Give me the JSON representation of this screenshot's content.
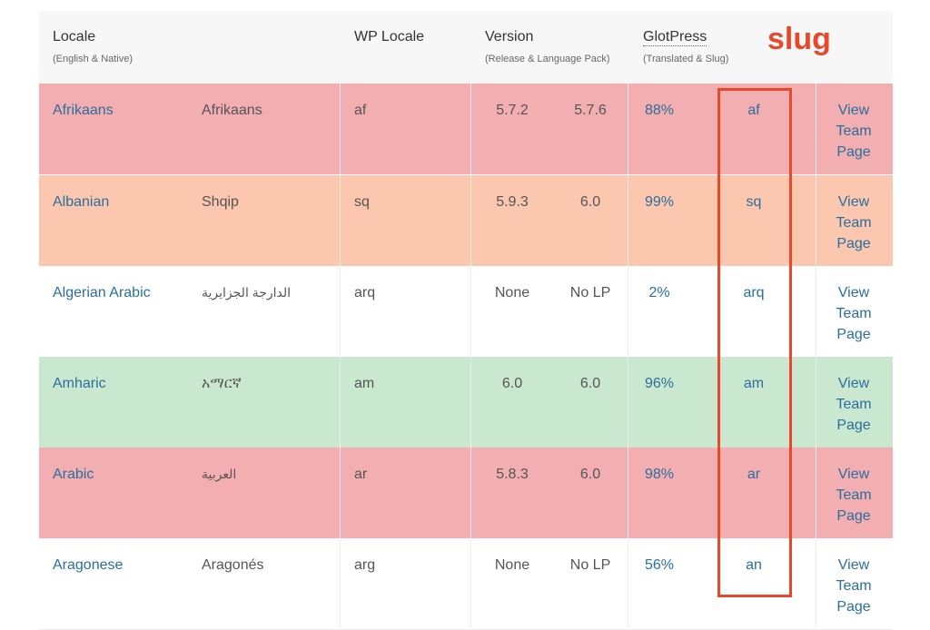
{
  "header": {
    "locale_title": "Locale",
    "locale_sub": "(English & Native)",
    "wp_locale_title": "WP Locale",
    "version_title": "Version",
    "version_sub": "(Release & Language Pack)",
    "glotpress_title": "GlotPress",
    "glotpress_sub": "(Translated & Slug)"
  },
  "annotation": {
    "slug_label": "slug",
    "highlight_color": "#e8492b"
  },
  "colors": {
    "red_row": "#f2aeb0",
    "orange_row": "#fbc7ae",
    "green_row": "#c9e8cf",
    "white_row": "#ffffff",
    "link": "#2a6f9e"
  },
  "rows": [
    {
      "english": "Afrikaans",
      "native": "Afrikaans",
      "wp_locale": "af",
      "release": "5.7.2",
      "language_pack": "5.7.6",
      "translated": "88%",
      "slug": "af",
      "view": [
        "View",
        "Team",
        "Page"
      ],
      "status": "red"
    },
    {
      "english": "Albanian",
      "native": "Shqip",
      "wp_locale": "sq",
      "release": "5.9.3",
      "language_pack": "6.0",
      "translated": "99%",
      "slug": "sq",
      "view": [
        "View",
        "Team",
        "Page"
      ],
      "status": "orange"
    },
    {
      "english": "Algerian Arabic",
      "native": "الدارجة الجزايرية",
      "wp_locale": "arq",
      "release": "None",
      "language_pack": "No LP",
      "translated": "2%",
      "slug": "arq",
      "view": [
        "View",
        "Team",
        "Page"
      ],
      "status": "white"
    },
    {
      "english": "Amharic",
      "native": "አማርኛ",
      "wp_locale": "am",
      "release": "6.0",
      "language_pack": "6.0",
      "translated": "96%",
      "slug": "am",
      "view": [
        "View",
        "Team",
        "Page"
      ],
      "status": "green"
    },
    {
      "english": "Arabic",
      "native": "العربية",
      "wp_locale": "ar",
      "release": "5.8.3",
      "language_pack": "6.0",
      "translated": "98%",
      "slug": "ar",
      "view": [
        "View",
        "Team",
        "Page"
      ],
      "status": "red"
    },
    {
      "english": "Aragonese",
      "native": "Aragonés",
      "wp_locale": "arg",
      "release": "None",
      "language_pack": "No LP",
      "translated": "56%",
      "slug": "an",
      "view": [
        "View",
        "Team",
        "Page"
      ],
      "status": "white"
    }
  ]
}
